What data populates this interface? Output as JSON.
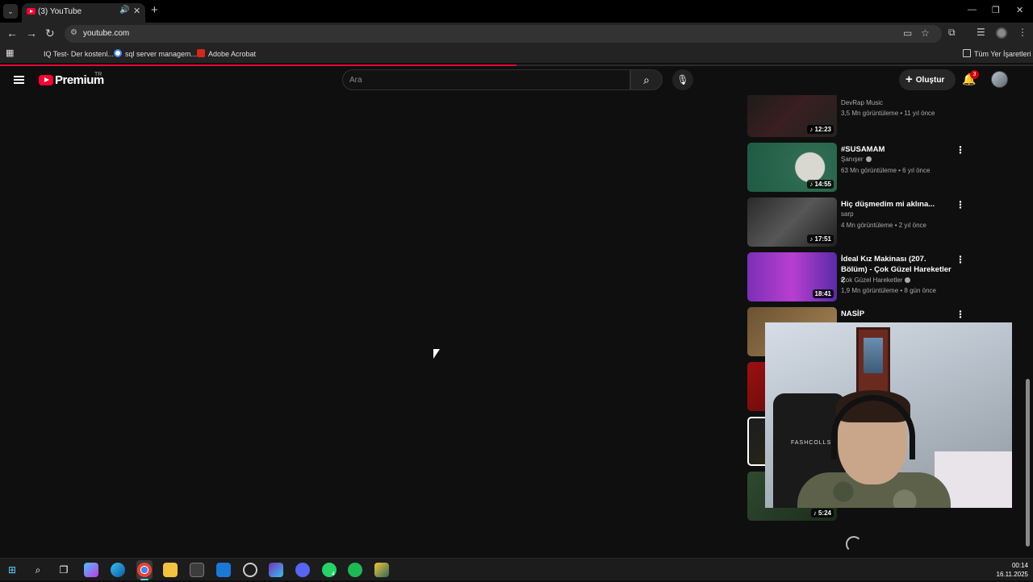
{
  "browser": {
    "tab_title": "(3) YouTube",
    "new_tab_symbol": "+",
    "url": "youtube.com",
    "bookmarks": [
      "IQ Test- Der kostenl...",
      "sql server managem...",
      "Adobe Acrobat"
    ],
    "all_bookmarks": "Tüm Yer İşaretleri",
    "page_load_progress": 0.5
  },
  "youtube": {
    "logo_text": "Premium",
    "country_code": "TR",
    "search_placeholder": "Ara",
    "create_label": "Oluştur",
    "notification_count": "3"
  },
  "videos": [
    {
      "title": "",
      "channel": "DevRap Music",
      "stats": "3,5 Mn görüntüleme • 11 yıl önce",
      "duration": "12:23",
      "verified": false
    },
    {
      "title": "#SUSAMAM",
      "channel": "Şanışer",
      "stats": "63 Mn görüntüleme • 6 yıl önce",
      "duration": "14:55",
      "verified": true
    },
    {
      "title": "Hiç düşmedim mi aklına...",
      "channel": "sarp",
      "stats": "4 Mn görüntüleme • 2 yıl önce",
      "duration": "17:51",
      "verified": false
    },
    {
      "title": "İdeal Kız Makinası (207. Bölüm) - Çok Güzel Hareketler 2",
      "channel": "Çok Güzel Hareketler",
      "stats": "1,9 Mn görüntüleme • 8 gün önce",
      "duration": "18:41",
      "verified": true
    },
    {
      "title": "NASİP",
      "channel": "",
      "stats": "",
      "duration": "",
      "verified": false
    },
    {
      "title": "",
      "channel": "",
      "stats": "",
      "duration": "",
      "verified": false
    },
    {
      "title": "",
      "channel": "",
      "stats": "",
      "duration": "",
      "verified": false
    },
    {
      "title": "",
      "channel": "",
      "stats": "",
      "duration": "5:24",
      "verified": false
    }
  ],
  "webcam": {
    "chair_text": "FASHCOLLS"
  },
  "taskbar": {
    "time": "00:14",
    "date": "16.11.2025",
    "whatsapp_badge": "4"
  },
  "colors": {
    "youtube_red": "#ff0033",
    "background": "#0f0f0f",
    "taskbar_accent": "#60cdff"
  }
}
